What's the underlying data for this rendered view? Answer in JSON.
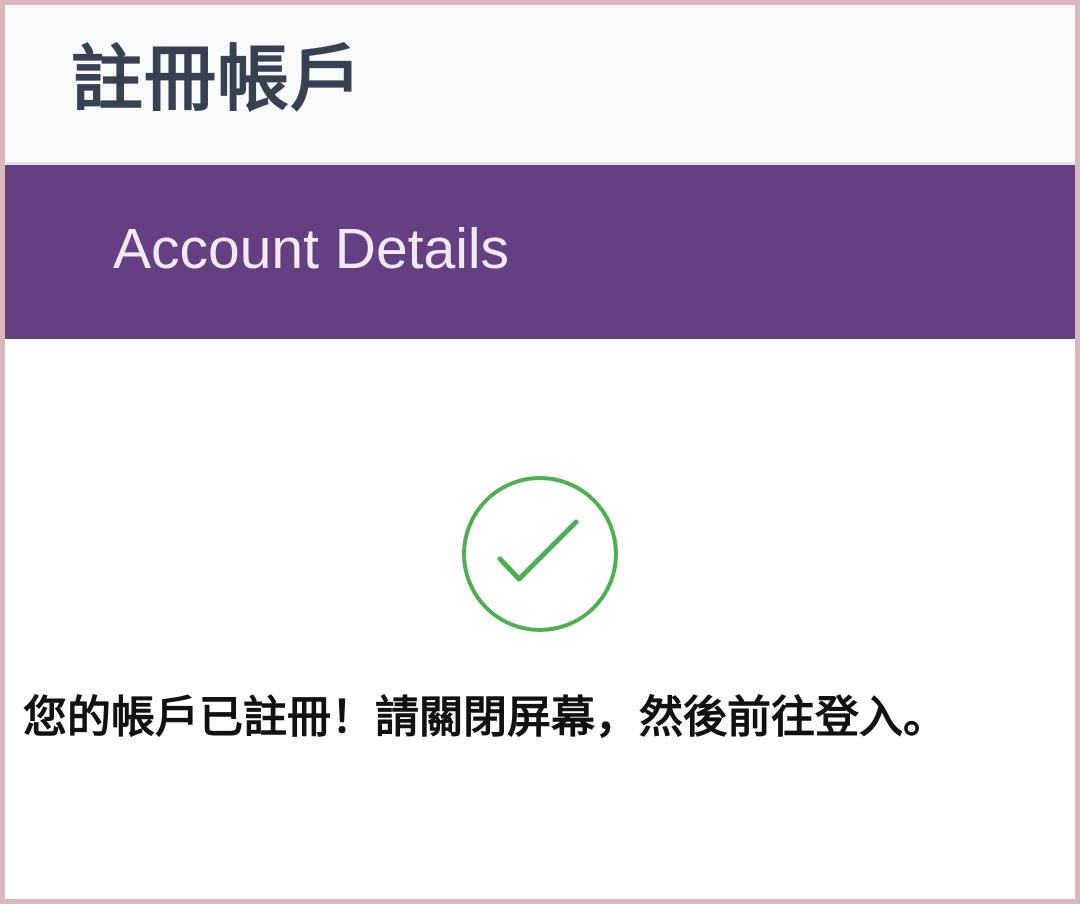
{
  "header": {
    "title": "註冊帳戶"
  },
  "section": {
    "title": "Account Details"
  },
  "status": {
    "icon": "check-circle-icon",
    "color": "#4caf50",
    "message": "您的帳戶已註冊！請關閉屏幕，然後前往登入。"
  },
  "colors": {
    "accent": "#643f82",
    "header_background": "#f9fafa",
    "title_text": "#374151"
  }
}
